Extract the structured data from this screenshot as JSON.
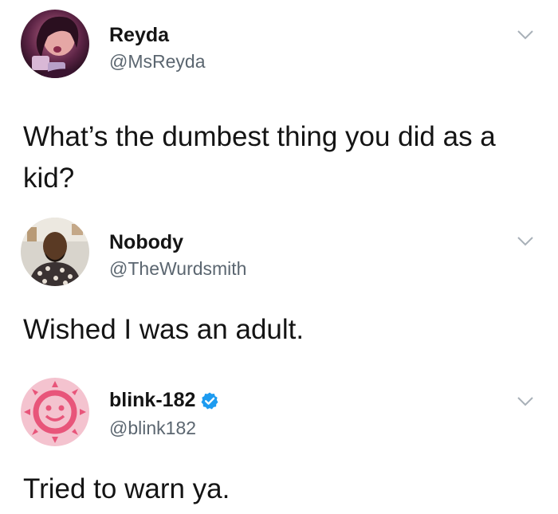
{
  "tweets": [
    {
      "display_name": "Reyda",
      "handle": "@MsReyda",
      "text": "What’s the dumbest thing you did as a kid?",
      "avatar_icon": "profile-photo-woman",
      "verified": false
    },
    {
      "display_name": "Nobody",
      "handle": "@TheWurdsmith",
      "text": "Wished I was an adult.",
      "avatar_icon": "profile-photo-man",
      "verified": false
    },
    {
      "display_name": "blink-182",
      "handle": "@blink182",
      "text": "Tried to warn ya.",
      "avatar_icon": "blink-182-smiley-logo",
      "verified": true
    }
  ],
  "colors": {
    "text": "#141414",
    "handle": "#5b6670",
    "verified": "#1d9bf0",
    "caret": "#a8b0b8",
    "logo_pink": "#e8557a",
    "logo_bg": "#f4c3cf"
  },
  "icons": {
    "menu": "chevron-down-icon",
    "verified": "verified-badge-icon"
  }
}
